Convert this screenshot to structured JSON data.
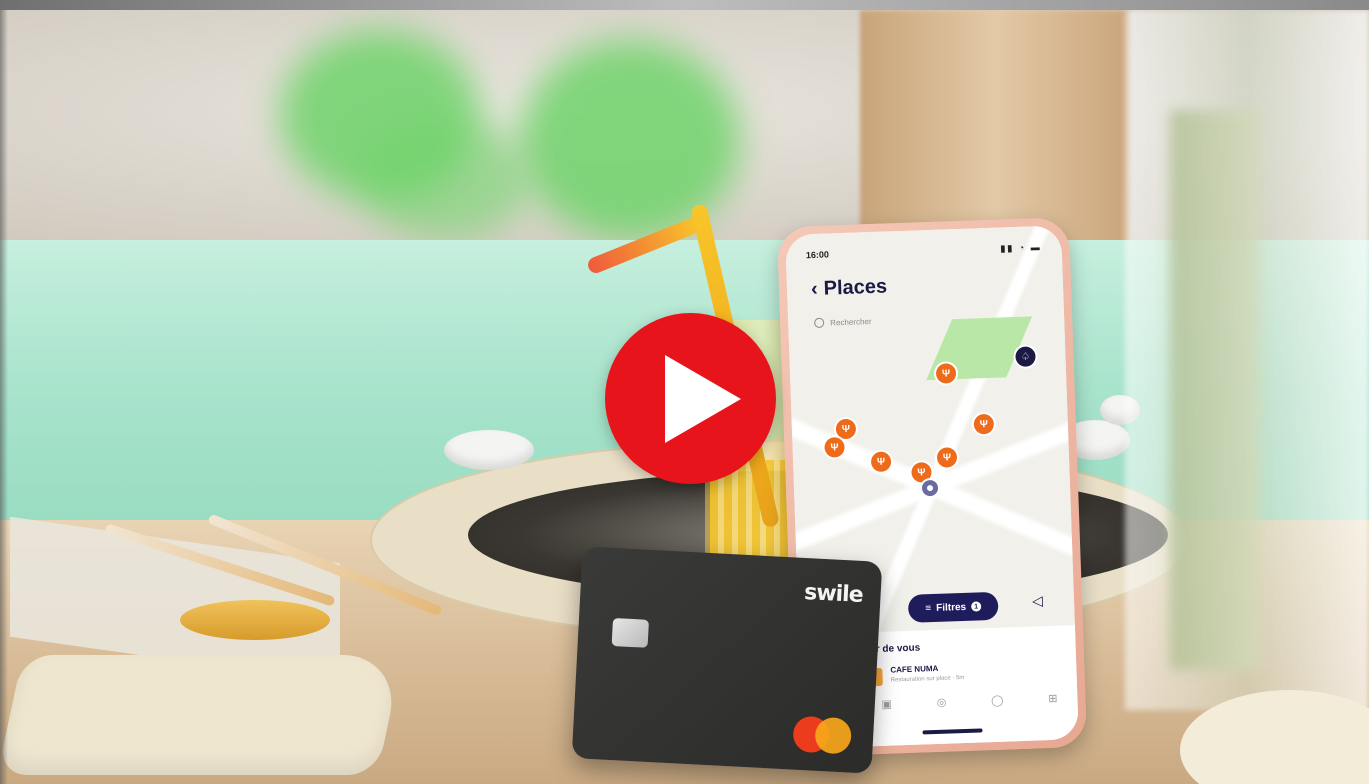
{
  "video": {
    "play_icon": "play-icon"
  },
  "phone": {
    "status_time": "16:00",
    "status_icons": "▮▮ ◔ ▬",
    "back_icon": "‹",
    "title": "Places",
    "search_placeholder": "Rechercher",
    "filters_label": "Filtres",
    "filters_badge": "1",
    "locate_icon": "◁",
    "sheet_heading": "ur de vous",
    "place_name": "CAFE NUMA",
    "place_subtitle": "Restauration sur place · 5m",
    "tabbar": [
      "▣",
      "◎",
      "◯",
      "⊞"
    ],
    "pin_glyph": "Ψ",
    "wallet_glyph": "♤"
  },
  "card": {
    "brand": "swile"
  },
  "colors": {
    "play_red": "#e8141b",
    "pin_orange": "#ef6b1c",
    "navy": "#1f1c5c"
  }
}
